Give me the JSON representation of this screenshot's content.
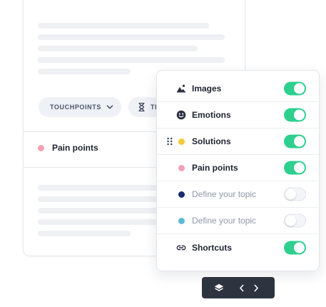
{
  "background_card": {
    "chip_touchpoints": "TOUCHPOINTS",
    "chip_second": "TI",
    "pain_points_label": "Pain points",
    "pain_points_color": "#f4a0b5"
  },
  "panel": {
    "rows": [
      {
        "label": "Images",
        "icon": "image-icon",
        "enabled": true
      },
      {
        "label": "Emotions",
        "icon": "emoji-icon",
        "enabled": true
      },
      {
        "label": "Solutions",
        "icon": "yellow-dot-icon",
        "color": "#f6c937",
        "enabled": true,
        "draggable": true
      },
      {
        "label": "Pain points",
        "icon": "pink-dot-icon",
        "color": "#f4a0b5",
        "enabled": true
      },
      {
        "label": "Define your topic",
        "icon": "navy-dot-icon",
        "color": "#1c2b6b",
        "enabled": false
      },
      {
        "label": "Define your topic",
        "icon": "cyan-dot-icon",
        "color": "#5fb9d6",
        "enabled": false
      },
      {
        "label": "Shortcuts",
        "icon": "link-icon",
        "enabled": true
      }
    ]
  },
  "toolbar": {
    "icons": [
      "layers-icon",
      "chevron-left-icon",
      "chevron-right-icon"
    ]
  },
  "colors": {
    "toggle_on": "#2ecf8f",
    "toolbar_bg": "#2e3340"
  }
}
